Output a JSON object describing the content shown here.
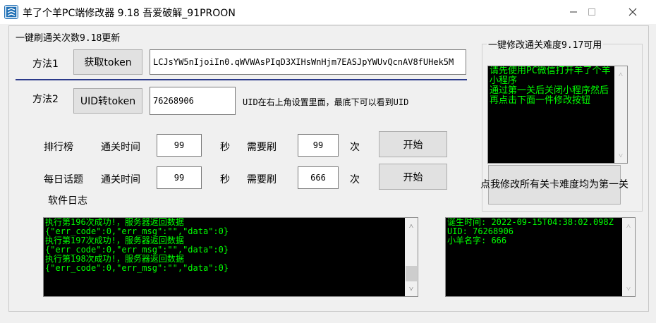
{
  "window": {
    "title": "羊了个羊PC端修改器 9.18 吾爱破解_91PROON",
    "minimize_icon": "minimize-icon",
    "maximize_icon": "maximize-icon",
    "close_icon": "close-icon"
  },
  "left_group": {
    "title": "一键刷通关次数9.18更新",
    "method1": {
      "label": "方法1",
      "button": "获取token",
      "token_value": "LCJsYW5nIjoiIn0.qWVWAsPIqD3XIHsWnHjm7EASJpYWUvQcnAV8fUHek5M"
    },
    "method2": {
      "label": "方法2",
      "button": "UID转token",
      "uid_value": "76268906",
      "hint": "UID在右上角设置里面，最底下可以看到UID"
    },
    "ranking": {
      "label": "排行榜",
      "time_label": "通关时间",
      "time_value": "99",
      "sec_label": "秒",
      "need_label": "需要刷",
      "count_value": "99",
      "times_label": "次",
      "start_button": "开始"
    },
    "daily": {
      "label": "每日话题",
      "time_label": "通关时间",
      "time_value": "99",
      "sec_label": "秒",
      "need_label": "需要刷",
      "count_value": "666",
      "times_label": "次",
      "start_button": "开始"
    },
    "log_label": "软件日志",
    "log_text": "执行第196次成功!，服务器返回数据\n{\"err_code\":0,\"err_msg\":\"\",\"data\":0}\n执行第197次成功!，服务器返回数据\n{\"err_code\":0,\"err_msg\":\"\",\"data\":0}\n执行第198次成功!，服务器返回数据\n{\"err_code\":0,\"err_msg\":\"\",\"data\":0}"
  },
  "right_group": {
    "title": "一键修改通关难度9.17可用",
    "instructions": "请先使用PC微信打开羊了个羊小程序\n通过第一关后关闭小程序然后再点击下面一件修改按钮",
    "modify_button": "点我修改所有关卡难度均为第一关",
    "info_text": "诞生时间: 2022-09-15T04:38:02.098Z\nUID: 76268906\n小羊名字: 666"
  },
  "colors": {
    "console_bg": "#000000",
    "console_text": "#00ff00",
    "divider": "#2b3a8a"
  }
}
